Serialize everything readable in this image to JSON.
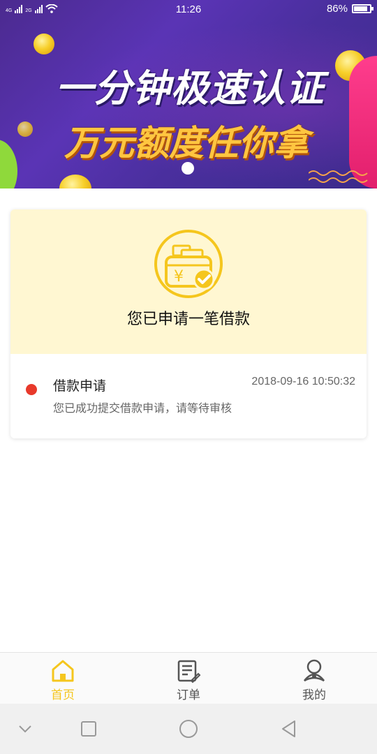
{
  "status_bar": {
    "network_left": "4G",
    "network_right": "2G",
    "time": "11:26",
    "battery": "86%",
    "battery_level": 0.86
  },
  "banner": {
    "headline": "一分钟极速认证",
    "subline": "万元额度任你拿",
    "colors": {
      "background": "#5a34b5",
      "headline": "#ffffff",
      "subline": "#ffc640"
    }
  },
  "card": {
    "icon": "wallet-check-icon",
    "title": "您已申请一笔借款",
    "timeline": [
      {
        "title": "借款申请",
        "time": "2018-09-16 10:50:32",
        "description": "您已成功提交借款申请，请等待审核",
        "status_color": "#e8392b"
      }
    ]
  },
  "tabbar": {
    "accent_color": "#f5c61d",
    "items": [
      {
        "label": "首页",
        "icon": "home-icon",
        "active": true
      },
      {
        "label": "订单",
        "icon": "orders-icon",
        "active": false
      },
      {
        "label": "我的",
        "icon": "profile-icon",
        "active": false
      }
    ]
  },
  "system_nav": {
    "buttons": [
      "chevron-down-icon",
      "recent-apps-icon",
      "home-circle-icon",
      "back-icon"
    ]
  }
}
